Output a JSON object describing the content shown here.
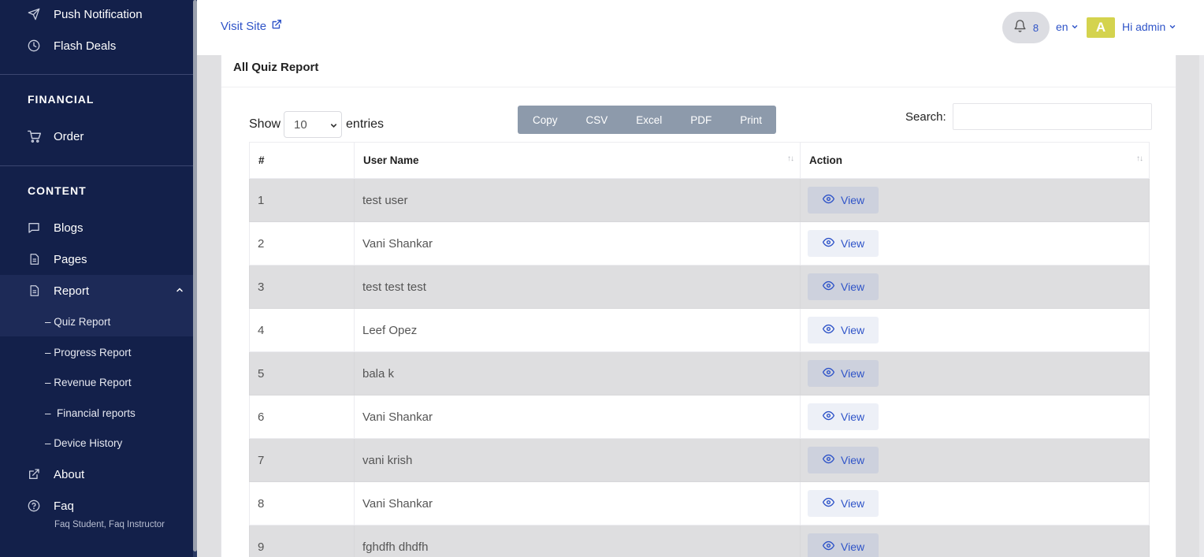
{
  "sidebar": {
    "items_top": [
      {
        "label": "Push Notification",
        "icon": "send-icon"
      },
      {
        "label": "Flash Deals",
        "icon": "clock-icon"
      }
    ],
    "financial_title": "FINANCIAL",
    "order_label": "Order",
    "content_title": "CONTENT",
    "blogs_label": "Blogs",
    "pages_label": "Pages",
    "report_label": "Report",
    "report_sub": [
      {
        "label": "– Quiz Report"
      },
      {
        "label": "– Progress Report"
      },
      {
        "label": "– Revenue Report"
      },
      {
        "label": "–  Financial reports"
      },
      {
        "label": "– Device History"
      }
    ],
    "about_label": "About",
    "faq_label": "Faq",
    "faq_caption": "Faq Student, Faq Instructor"
  },
  "topbar": {
    "visit_site": "Visit Site",
    "notification_count": "8",
    "language": "en",
    "avatar_letter": "A",
    "greeting": "Hi admin"
  },
  "card": {
    "title": "All Quiz Report",
    "show_label": "Show",
    "entries_value": "10",
    "entries_label": "entries",
    "buttons": [
      "Copy",
      "CSV",
      "Excel",
      "PDF",
      "Print"
    ],
    "search_label": "Search:",
    "search_value": ""
  },
  "table": {
    "headers": [
      "#",
      "User Name",
      "Action"
    ],
    "view_label": "View",
    "rows": [
      {
        "num": "1",
        "name": "test user"
      },
      {
        "num": "2",
        "name": "Vani Shankar"
      },
      {
        "num": "3",
        "name": "test test test"
      },
      {
        "num": "4",
        "name": "Leef Opez"
      },
      {
        "num": "5",
        "name": "bala k"
      },
      {
        "num": "6",
        "name": "Vani Shankar"
      },
      {
        "num": "7",
        "name": "vani krish"
      },
      {
        "num": "8",
        "name": "Vani Shankar"
      },
      {
        "num": "9",
        "name": "fghdfh dhdfh"
      }
    ]
  },
  "colors": {
    "sidebar_bg": "#13204a",
    "accent": "#2f54c8",
    "avatar": "#d4d34e",
    "export_buttons": "#8d9aab"
  }
}
